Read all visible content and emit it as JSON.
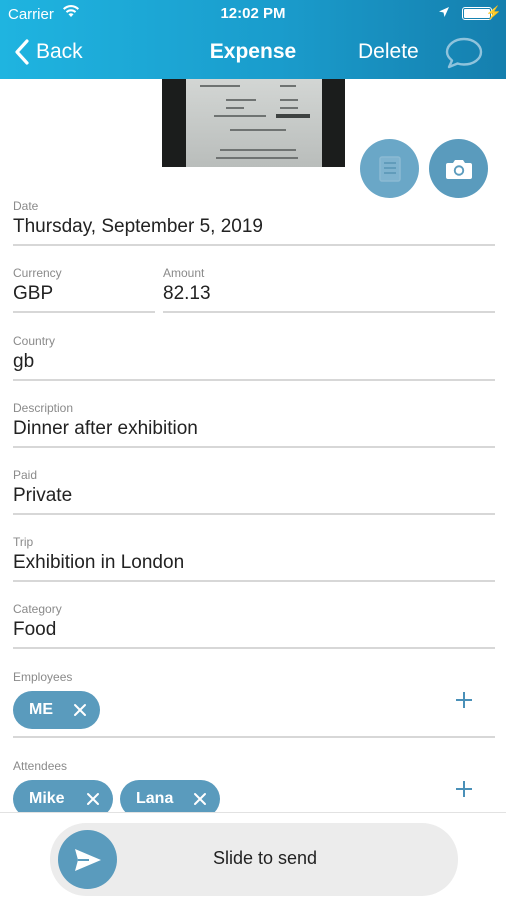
{
  "status_bar": {
    "carrier": "Carrier",
    "time": "12:02 PM"
  },
  "nav": {
    "back_label": "Back",
    "title": "Expense",
    "delete_label": "Delete"
  },
  "receipt_image": {
    "icon": "receipt-photo"
  },
  "actions": {
    "document_icon": "document-icon",
    "camera_icon": "camera-icon"
  },
  "form": {
    "date": {
      "label": "Date",
      "value": "Thursday, September 5, 2019"
    },
    "currency": {
      "label": "Currency",
      "value": "GBP"
    },
    "amount": {
      "label": "Amount",
      "value": "82.13"
    },
    "country": {
      "label": "Country",
      "value": "gb"
    },
    "description": {
      "label": "Description",
      "value": "Dinner after exhibition"
    },
    "paid": {
      "label": "Paid",
      "value": "Private"
    },
    "trip": {
      "label": "Trip",
      "value": "Exhibition in London"
    },
    "category": {
      "label": "Category",
      "value": "Food"
    },
    "employees": {
      "label": "Employees",
      "chips": [
        "ME"
      ]
    },
    "attendees": {
      "label": "Attendees",
      "chips": [
        "Mike",
        "Lana"
      ]
    }
  },
  "slide_to_send": {
    "label": "Slide to send"
  },
  "colors": {
    "accent": "#5a9bbd",
    "nav_start": "#1fb4e0",
    "nav_end": "#157fae"
  }
}
